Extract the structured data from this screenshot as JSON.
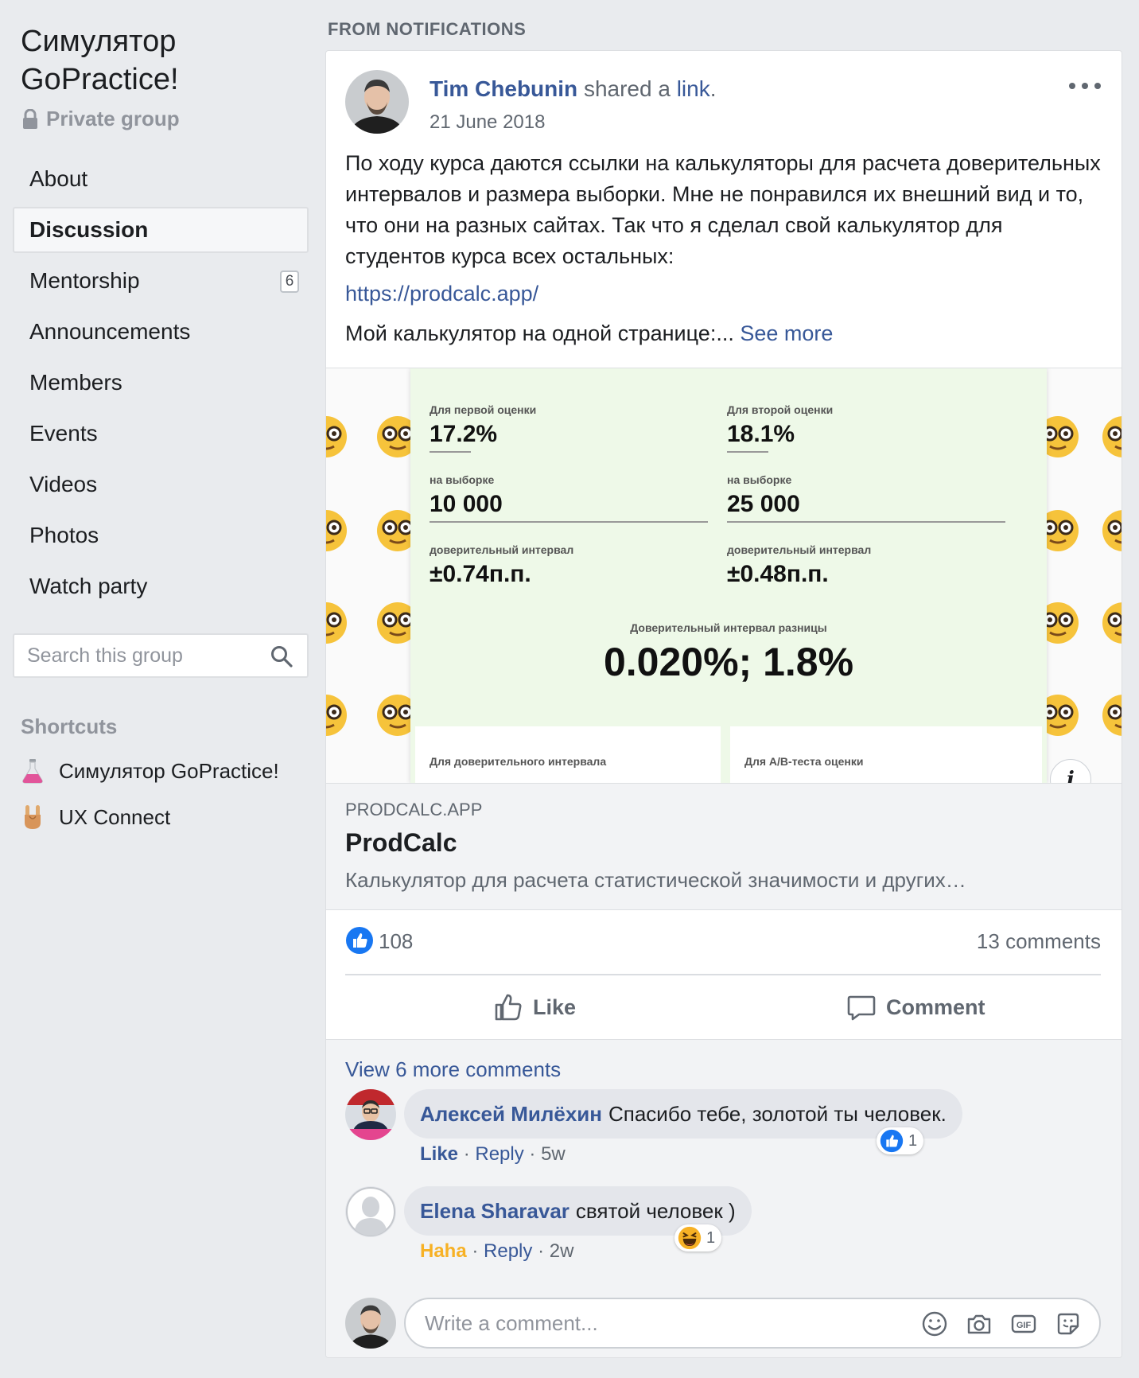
{
  "sidebar": {
    "group_title": "Симулятор GoPractice!",
    "privacy": "Private group",
    "nav": [
      {
        "label": "About"
      },
      {
        "label": "Discussion",
        "active": true
      },
      {
        "label": "Mentorship",
        "badge": "6"
      },
      {
        "label": "Announcements"
      },
      {
        "label": "Members"
      },
      {
        "label": "Events"
      },
      {
        "label": "Videos"
      },
      {
        "label": "Photos"
      },
      {
        "label": "Watch party"
      }
    ],
    "search_placeholder": "Search this group",
    "shortcuts_heading": "Shortcuts",
    "shortcuts": [
      {
        "label": "Симулятор GoPractice!",
        "icon": "flask-icon"
      },
      {
        "label": "UX Connect",
        "icon": "rock-hand-icon"
      }
    ]
  },
  "feed": {
    "label": "FROM NOTIFICATIONS"
  },
  "post": {
    "author": "Tim Chebunin",
    "action_text": "shared a",
    "action_link": "link",
    "action_end": ".",
    "date": "21 June 2018",
    "text": "По ходу курса даются ссылки на калькуляторы для расчета доверительных интервалов и размера выборки. Мне не понравился их внешний вид и то, что они на разных сайтах. Так что я сделал свой калькулятор для студентов курса всех остальных:",
    "url": "https://prodcalc.app/",
    "more_text": "Мой калькулятор на одной странице:...",
    "see_more": "See more",
    "calc": {
      "first_label": "Для первой оценки",
      "first_value": "17.2%",
      "second_label": "Для второй оценки",
      "second_value": "18.1%",
      "sample_label": "на выборке",
      "sample1": "10 000",
      "sample2": "25 000",
      "ci_label": "доверительный интервал",
      "ci1": "±0.74п.п.",
      "ci2": "±0.48п.п.",
      "diff_label": "Доверительный интервал разницы",
      "diff_value": "0.020%; 1.8%",
      "sub1_label": "Для доверительного интервала",
      "sub2_label": "Для A/B-теста оценки"
    },
    "link_domain": "PRODCALC.APP",
    "link_title": "ProdCalc",
    "link_desc": "Калькулятор для расчета статистической значимости и других…",
    "likes": "108",
    "comments_count": "13 comments",
    "like_label": "Like",
    "comment_label": "Comment"
  },
  "comments": {
    "view_more": "View 6 more comments",
    "items": [
      {
        "name": "Алексей Милёхин",
        "text": "Спасибо тебе, золотой ты человек.",
        "reaction_count": "1",
        "action": "Like",
        "reply": "Reply",
        "time": "5w",
        "reaction": "like-reaction-icon"
      },
      {
        "name": "Elena Sharavar",
        "text": "святой человек )",
        "reaction_count": "1",
        "action": "Haha",
        "reply": "Reply",
        "time": "2w",
        "reaction": "haha-reaction-icon"
      }
    ],
    "compose_placeholder": "Write a comment...",
    "sep": "·"
  },
  "colors": {
    "link_blue": "#385898",
    "facebook_blue": "#1877f2",
    "haha_yellow": "#f7b125",
    "background": "#e9ebee"
  }
}
